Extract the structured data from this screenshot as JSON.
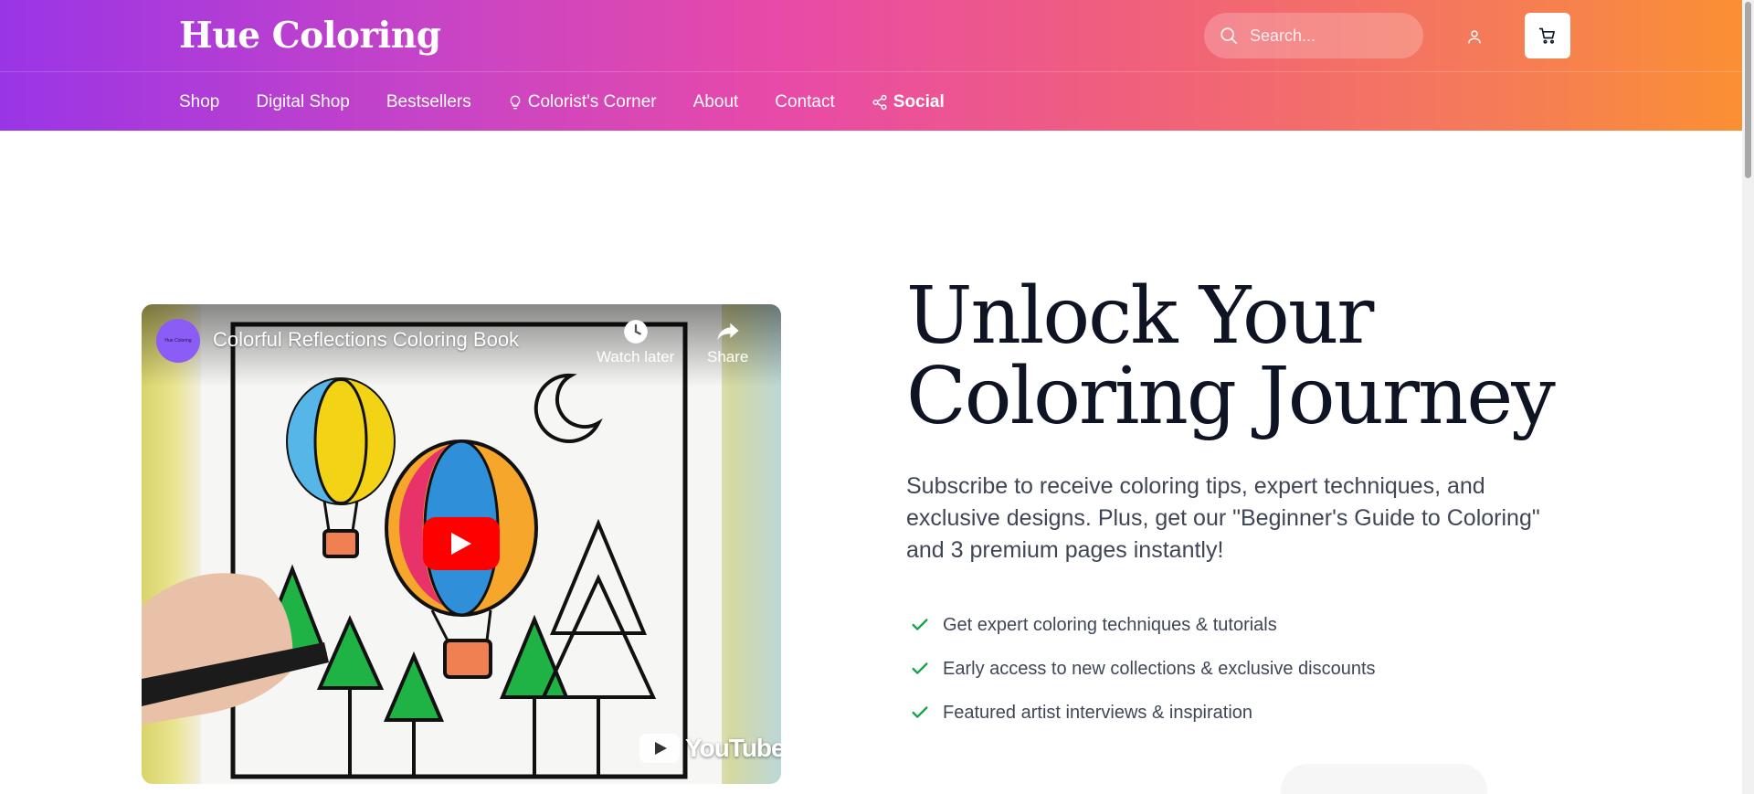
{
  "header": {
    "brand": "Hue Coloring",
    "search_placeholder": "Search..."
  },
  "nav": {
    "items": [
      {
        "label": "Shop"
      },
      {
        "label": "Digital Shop"
      },
      {
        "label": "Bestsellers"
      },
      {
        "label": "Colorist's Corner",
        "icon": "lightbulb-icon"
      },
      {
        "label": "About"
      },
      {
        "label": "Contact"
      },
      {
        "label": "Social",
        "icon": "share-icon"
      }
    ]
  },
  "video": {
    "channel_avatar_text": "Hue Coloring",
    "title": "Colorful Reflections Coloring Book",
    "watch_later_label": "Watch later",
    "share_label": "Share",
    "youtube_label": "YouTube"
  },
  "hero": {
    "title_line1": "Unlock Your",
    "title_line2": "Coloring Journey",
    "subtitle": "Subscribe to receive coloring tips, expert techniques, and exclusive designs. Plus, get our \"Beginner's Guide to Coloring\" and 3 premium pages instantly!",
    "benefits": [
      "Get expert coloring techniques & tutorials",
      "Early access to new collections & exclusive discounts",
      "Featured artist interviews & inspiration"
    ]
  },
  "colors": {
    "gradient_start": "#9a35e6",
    "gradient_mid": "#e84aa7",
    "gradient_end": "#fa9034",
    "check_green": "#16a34a",
    "youtube_red": "#ff0000"
  }
}
